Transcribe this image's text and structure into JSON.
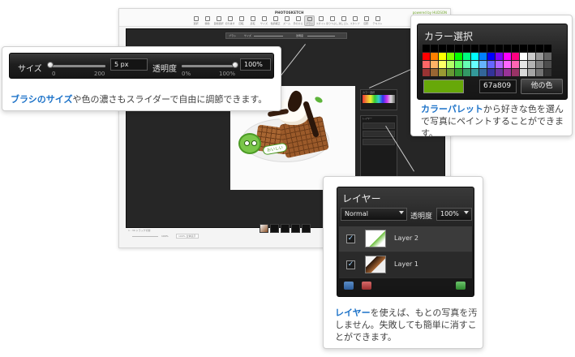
{
  "app": {
    "logo_text": "PHOTOSKETCH",
    "powered_text": "powered by HUDSON",
    "toolbar": [
      {
        "label": "選択",
        "icon": "select-icon"
      },
      {
        "label": "移動",
        "icon": "move-icon"
      },
      {
        "label": "自動選択",
        "icon": "magic-wand-icon"
      },
      {
        "label": "切り抜き",
        "icon": "crop-icon"
      },
      {
        "label": "回転",
        "icon": "rotate-icon"
      },
      {
        "label": "反転",
        "icon": "flip-icon"
      },
      {
        "label": "サイズ",
        "icon": "resize-icon"
      },
      {
        "label": "色調補正",
        "icon": "adjust-icon"
      },
      {
        "label": "ズーム",
        "icon": "zoom-icon"
      },
      {
        "label": "手のひら",
        "icon": "hand-icon"
      },
      {
        "label": "ブラシ",
        "icon": "brush-icon",
        "active": true
      },
      {
        "label": "スポイト",
        "icon": "eyedropper-icon"
      },
      {
        "label": "塗りつぶし",
        "icon": "fill-icon"
      },
      {
        "label": "消しゴム",
        "icon": "eraser-icon"
      },
      {
        "label": "スタンプ",
        "icon": "stamp-icon"
      },
      {
        "label": "図形",
        "icon": "shape-icon"
      },
      {
        "label": "テキスト",
        "icon": "text-icon"
      }
    ],
    "options_bar": {
      "brush_label": "ブラシ",
      "size_label": "サイズ",
      "opacity_label": "透明度"
    },
    "photo_bubble_text": "おいしい",
    "side_palette_title": "カラー選択",
    "side_layer_title": "レイヤー",
    "zoom_line": "1 : 30   ドラッグ切替",
    "bottom": {
      "zoom_pct": "100%",
      "fit_button": "100% 全体表示",
      "save_button": "保存",
      "cancel_button": "戻る"
    }
  },
  "brush_callout": {
    "size_label": "サイズ",
    "size_min": "0",
    "size_max": "200",
    "size_value": "5 px",
    "size_level": 0.03,
    "opacity_label": "透明度",
    "opacity_min": "0%",
    "opacity_max": "100%",
    "opacity_value": "100%",
    "opacity_level": 1.0,
    "caption_bold": "ブラシのサイズ",
    "caption_rest": "や色の濃さもスライダーで自由に調節できます。"
  },
  "color_callout": {
    "title": "カラー選択",
    "current_color": "#67a809",
    "hex_value": "67a809",
    "other_button": "他の色",
    "swatches": [
      "#000000",
      "#000000",
      "#000000",
      "#000000",
      "#000000",
      "#000000",
      "#000000",
      "#000000",
      "#000000",
      "#000000",
      "#000000",
      "#000000",
      "#000000",
      "#000000",
      "#000000",
      "#000000",
      "#ff0000",
      "#ff8000",
      "#ffff00",
      "#80ff00",
      "#00ff00",
      "#00ff80",
      "#00ffff",
      "#0080ff",
      "#0000ff",
      "#8000ff",
      "#ff00ff",
      "#ff0080",
      "#ffffff",
      "#cccccc",
      "#999999",
      "#666666",
      "#ff6666",
      "#ffb366",
      "#ffff66",
      "#b3ff66",
      "#66ff66",
      "#66ffb3",
      "#66ffff",
      "#66b3ff",
      "#6666ff",
      "#b366ff",
      "#ff66ff",
      "#ff66b3",
      "#e6e6e6",
      "#b3b3b3",
      "#808080",
      "#4d4d4d",
      "#993333",
      "#996633",
      "#999933",
      "#669933",
      "#339933",
      "#339966",
      "#339999",
      "#336699",
      "#333399",
      "#663399",
      "#993399",
      "#993366",
      "#d9d9d9",
      "#a6a6a6",
      "#737373",
      "#333333"
    ],
    "caption_bold": "カラーパレット",
    "caption_rest": "から好きな色を選んで写真にペイントすることができます。"
  },
  "layer_callout": {
    "title": "レイヤー",
    "blend_mode": "Normal",
    "opacity_label": "透明度",
    "opacity_value": "100%",
    "layers": [
      {
        "name": "Layer 2",
        "checked": true
      },
      {
        "name": "Layer 1",
        "checked": true
      }
    ],
    "caption_bold": "レイヤー",
    "caption_rest": "を使えば、もとの写真を汚しません。失敗しても簡単に消すことができます。"
  },
  "colors": {
    "caption_accent": "#1c72c8",
    "canvas_bg": "#262626",
    "panel_bg": "#1b1b1b"
  }
}
